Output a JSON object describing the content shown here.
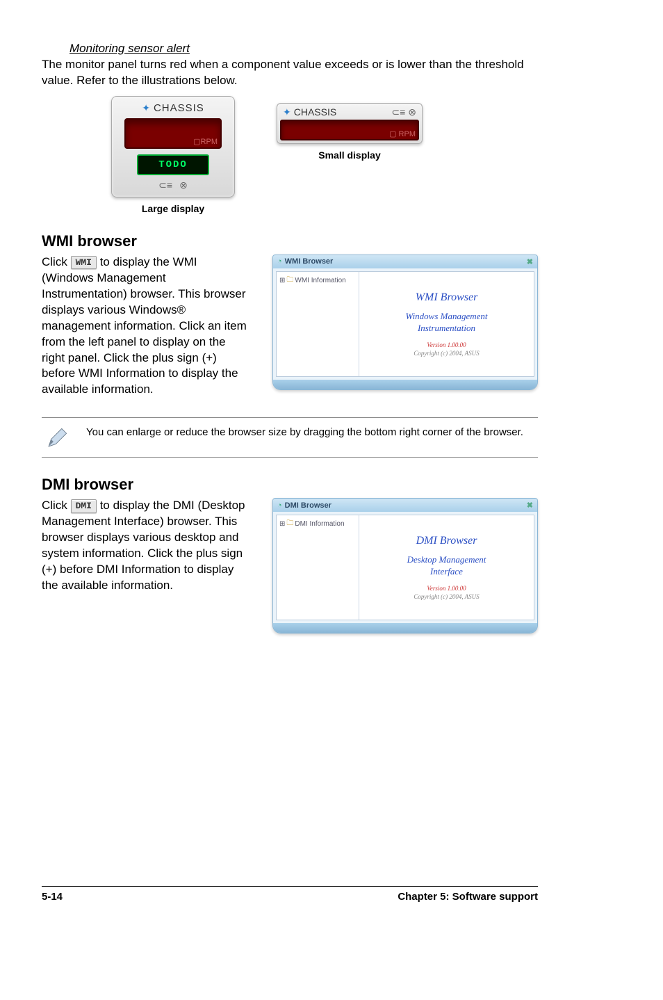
{
  "monitoring": {
    "heading": "Monitoring sensor alert",
    "body": "The monitor panel turns red when a component value exceeds or is lower than the threshold value. Refer to the illustrations below.",
    "gauge_label": "CHASSIS",
    "rpm_unit": "RPM",
    "large_readout": "TODO",
    "large_caption": "Large display",
    "small_caption": "Small display"
  },
  "wmi": {
    "heading": "WMI browser",
    "btn": "WMI",
    "para_before": "Click ",
    "para_after": " to display the WMI (Windows Management Instrumentation) browser. This browser displays various Windows® management information. Click an item from the left panel to display on the right panel. Click the plus sign (+) before WMI Information to display the available information.",
    "window_title": "WMI Browser",
    "tree_root": "WMI Information",
    "content_title": "WMI Browser",
    "content_sub1": "Windows Management",
    "content_sub2": "Instrumentation",
    "version": "Version 1.00.00",
    "copyright": "Copyright (c) 2004, ASUS"
  },
  "note": {
    "text": "You can enlarge or reduce the browser size by dragging the bottom right corner of the browser."
  },
  "dmi": {
    "heading": "DMI browser",
    "btn": "DMI",
    "para_before": "Click ",
    "para_after": " to display the DMI (Desktop Management Interface) browser. This browser displays various desktop and system information. Click the plus sign (+) before DMI Information to display the available information.",
    "window_title": "DMI Browser",
    "tree_root": "DMI Information",
    "content_title": "DMI Browser",
    "content_sub1": "Desktop Management",
    "content_sub2": "Interface",
    "version": "Version 1.00.00",
    "copyright": "Copyright (c) 2004, ASUS"
  },
  "footer": {
    "left": "5-14",
    "right": "Chapter 5: Software support"
  }
}
